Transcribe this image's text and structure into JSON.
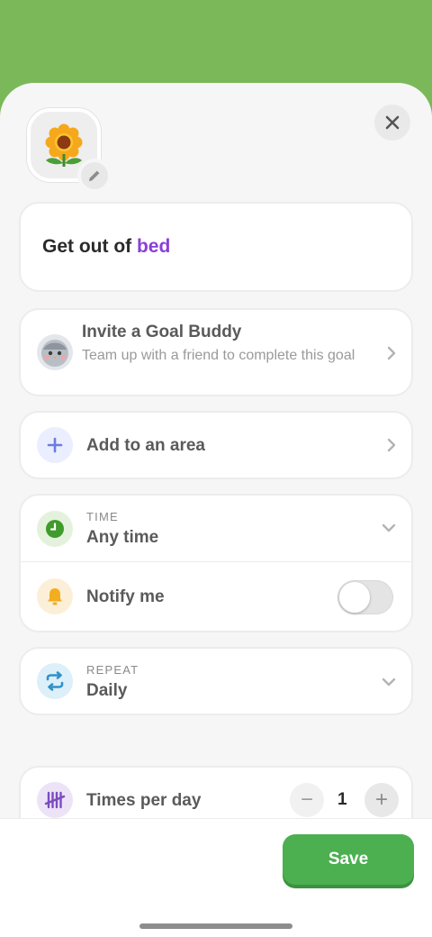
{
  "goal": {
    "icon": "sunflower-icon",
    "title_prefix": "Get out of ",
    "title_accent": "bed",
    "accent_color": "#8a3fd6"
  },
  "buddy": {
    "title": "Invite a Goal Buddy",
    "subtitle": "Team up with a friend to complete this goal"
  },
  "area": {
    "label": "Add to an area"
  },
  "time": {
    "caption": "TIME",
    "value": "Any time"
  },
  "notify": {
    "label": "Notify me",
    "enabled": false
  },
  "repeat": {
    "caption": "REPEAT",
    "value": "Daily"
  },
  "times_per_day": {
    "label": "Times per day",
    "value": "1",
    "decrement": "−",
    "increment": "+"
  },
  "footer": {
    "save_label": "Save",
    "save_color": "#4caf50"
  },
  "colors": {
    "header_bg": "#7bb85a"
  }
}
